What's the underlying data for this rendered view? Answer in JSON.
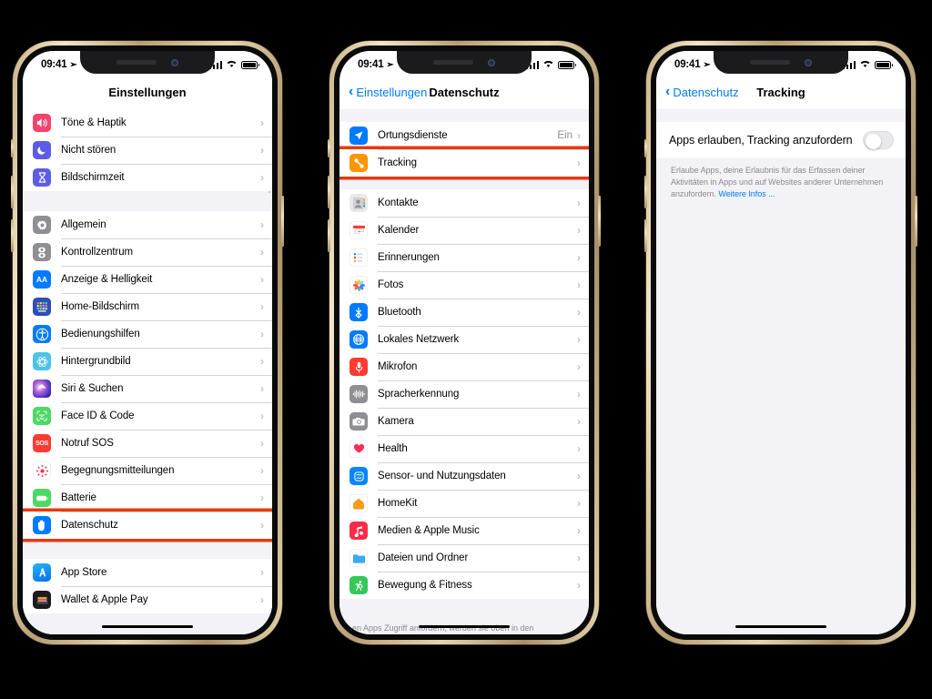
{
  "statusbar": {
    "time": "09:41",
    "location_icon": "location-arrow-icon",
    "wifi_icon": "wifi-icon",
    "battery_icon": "battery-icon",
    "cellular_icon": "cellular-bars-icon"
  },
  "colors": {
    "accent": "#007aff",
    "highlight": "#e8380d",
    "grouped_bg": "#f2f2f7",
    "row_bg": "#ffffff",
    "secondary_text": "#8e8e93"
  },
  "phone1": {
    "nav": {
      "title": "Einstellungen",
      "back_label": ""
    },
    "groups": [
      {
        "rows": [
          {
            "label": "Töne & Haptik",
            "icon": "sound-icon",
            "value": "",
            "highlighted": false
          },
          {
            "label": "Nicht stören",
            "icon": "moon-icon",
            "value": "",
            "highlighted": false
          },
          {
            "label": "Bildschirmzeit",
            "icon": "hourglass-icon",
            "value": "",
            "highlighted": false
          }
        ]
      },
      {
        "rows": [
          {
            "label": "Allgemein",
            "icon": "gear-icon",
            "value": "",
            "highlighted": false
          },
          {
            "label": "Kontrollzentrum",
            "icon": "control-center-icon",
            "value": "",
            "highlighted": false
          },
          {
            "label": "Anzeige & Helligkeit",
            "icon": "display-aa-icon",
            "value": "",
            "highlighted": false
          },
          {
            "label": "Home-Bildschirm",
            "icon": "home-screen-icon",
            "value": "",
            "highlighted": false
          },
          {
            "label": "Bedienungshilfen",
            "icon": "accessibility-icon",
            "value": "",
            "highlighted": false
          },
          {
            "label": "Hintergrundbild",
            "icon": "wallpaper-icon",
            "value": "",
            "highlighted": false
          },
          {
            "label": "Siri & Suchen",
            "icon": "siri-icon",
            "value": "",
            "highlighted": false
          },
          {
            "label": "Face ID & Code",
            "icon": "face-id-icon",
            "value": "",
            "highlighted": false
          },
          {
            "label": "Notruf SOS",
            "icon": "sos-icon",
            "value": "",
            "highlighted": false
          },
          {
            "label": "Begegnungsmitteilungen",
            "icon": "exposure-notifications-icon",
            "value": "",
            "highlighted": false
          },
          {
            "label": "Batterie",
            "icon": "battery-green-icon",
            "value": "",
            "highlighted": false
          },
          {
            "label": "Datenschutz",
            "icon": "privacy-hand-icon",
            "value": "",
            "highlighted": true
          }
        ]
      },
      {
        "rows": [
          {
            "label": "App Store",
            "icon": "app-store-icon",
            "value": "",
            "highlighted": false
          },
          {
            "label": "Wallet & Apple Pay",
            "icon": "wallet-icon",
            "value": "",
            "highlighted": false
          }
        ]
      }
    ]
  },
  "phone2": {
    "nav": {
      "back_label": "Einstellungen",
      "title": "Datenschutz"
    },
    "groups": [
      {
        "rows": [
          {
            "label": "Ortungsdienste",
            "icon": "location-services-icon",
            "value": "Ein",
            "highlighted": false
          },
          {
            "label": "Tracking",
            "icon": "tracking-icon",
            "value": "",
            "highlighted": true
          }
        ]
      },
      {
        "rows": [
          {
            "label": "Kontakte",
            "icon": "contacts-icon",
            "value": "",
            "highlighted": false
          },
          {
            "label": "Kalender",
            "icon": "calendar-icon",
            "value": "",
            "highlighted": false
          },
          {
            "label": "Erinnerungen",
            "icon": "reminders-icon",
            "value": "",
            "highlighted": false
          },
          {
            "label": "Fotos",
            "icon": "photos-icon",
            "value": "",
            "highlighted": false
          },
          {
            "label": "Bluetooth",
            "icon": "bluetooth-icon",
            "value": "",
            "highlighted": false
          },
          {
            "label": "Lokales Netzwerk",
            "icon": "local-network-icon",
            "value": "",
            "highlighted": false
          },
          {
            "label": "Mikrofon",
            "icon": "microphone-icon",
            "value": "",
            "highlighted": false
          },
          {
            "label": "Spracherkennung",
            "icon": "speech-recognition-icon",
            "value": "",
            "highlighted": false
          },
          {
            "label": "Kamera",
            "icon": "camera-icon",
            "value": "",
            "highlighted": false
          },
          {
            "label": "Health",
            "icon": "health-heart-icon",
            "value": "",
            "highlighted": false
          },
          {
            "label": "Sensor- und Nutzungsdaten",
            "icon": "research-sensor-icon",
            "value": "",
            "highlighted": false
          },
          {
            "label": "HomeKit",
            "icon": "homekit-icon",
            "value": "",
            "highlighted": false
          },
          {
            "label": "Medien & Apple Music",
            "icon": "music-icon",
            "value": "",
            "highlighted": false
          },
          {
            "label": "Dateien und Ordner",
            "icon": "files-folder-icon",
            "value": "",
            "highlighted": false
          },
          {
            "label": "Bewegung & Fitness",
            "icon": "fitness-icon",
            "value": "",
            "highlighted": false
          }
        ]
      }
    ],
    "cut_footnote": "en Apps Zugriff anfordern, werden sie oben in den"
  },
  "phone3": {
    "nav": {
      "back_label": "Datenschutz",
      "title": "Tracking"
    },
    "toggle_row": {
      "label": "Apps erlauben, Tracking anzufordern",
      "state": "off"
    },
    "footnote": {
      "text": "Erlaube Apps, deine Erlaubnis für das Erfassen deiner Aktivitäten in Apps und auf Websites anderer Unternehmen anzufordern. ",
      "link": "Weitere Infos ..."
    }
  }
}
